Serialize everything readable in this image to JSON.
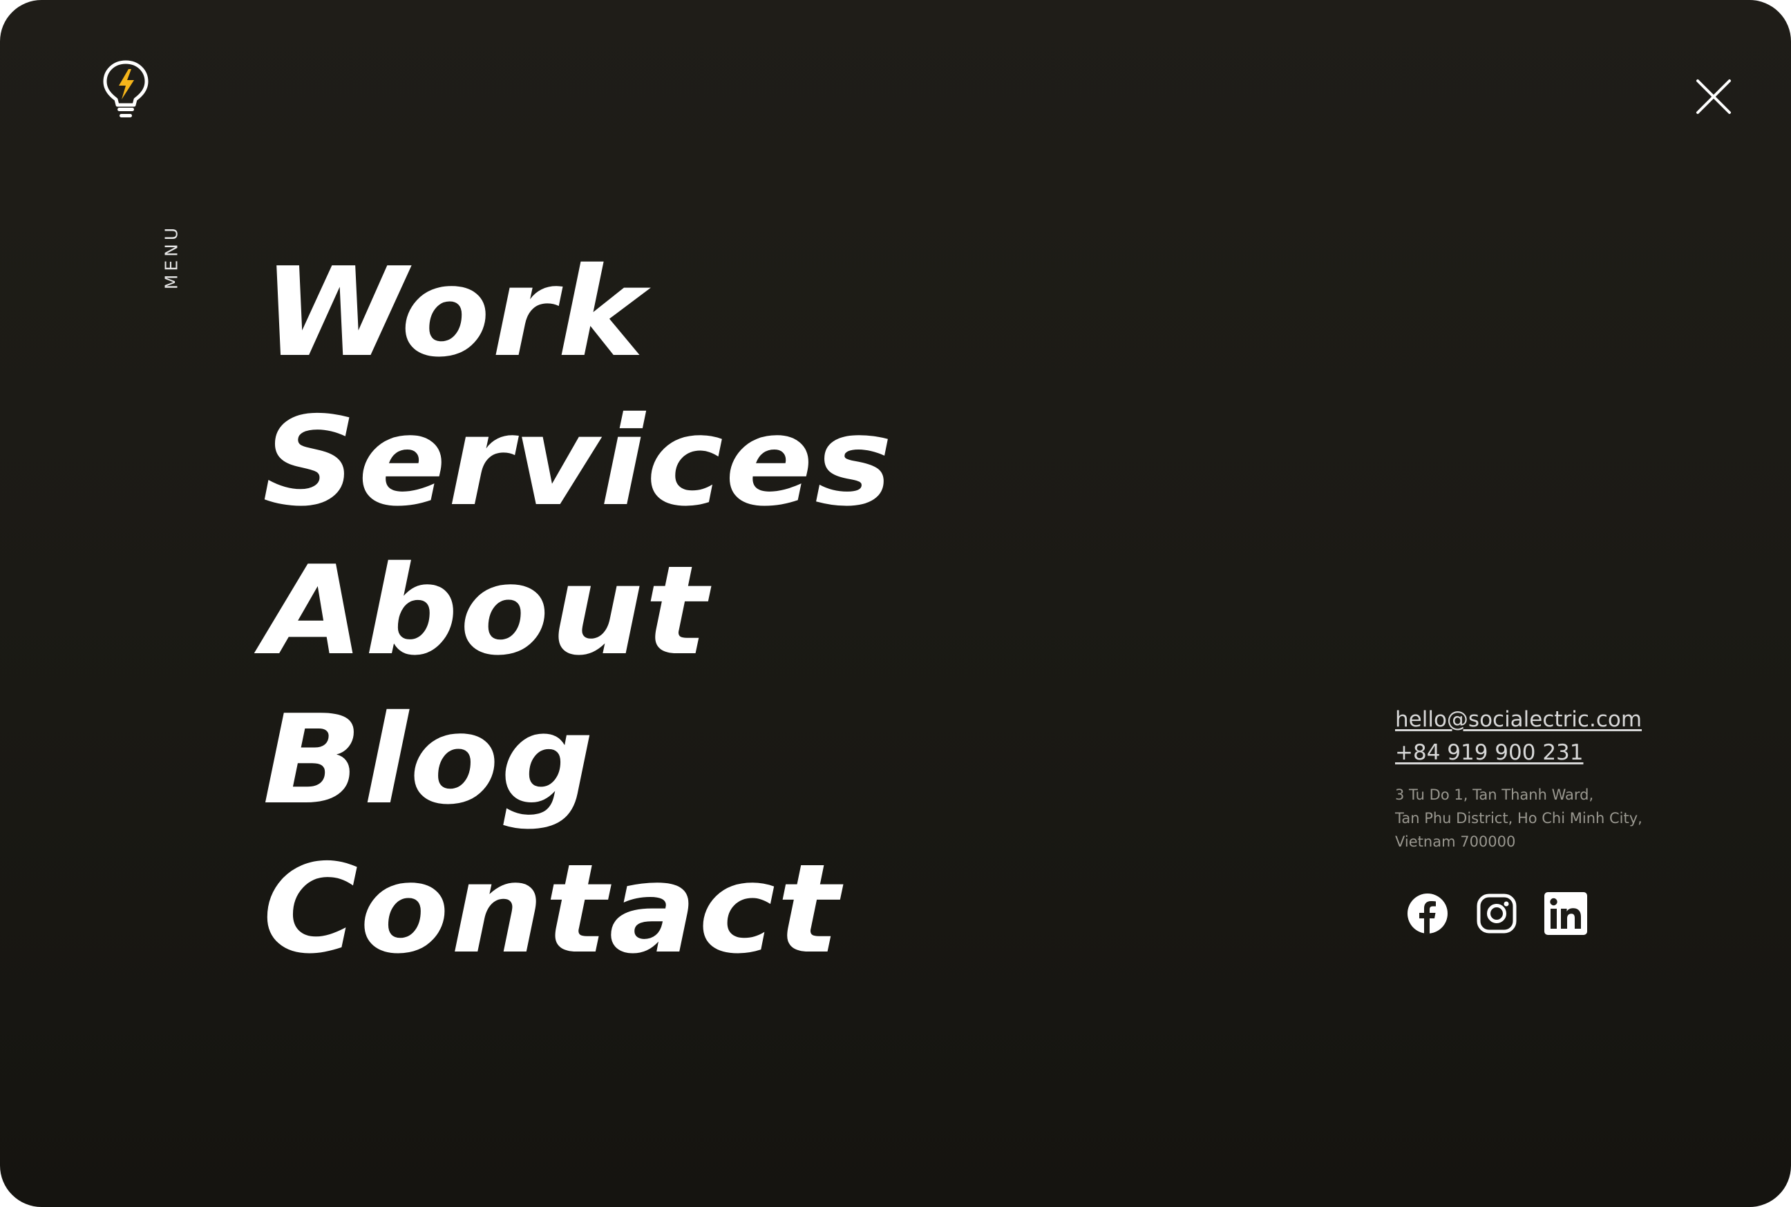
{
  "menu": {
    "label": "MENU",
    "items": [
      {
        "label": "Work"
      },
      {
        "label": "Services"
      },
      {
        "label": "About"
      },
      {
        "label": "Blog"
      },
      {
        "label": "Contact"
      }
    ]
  },
  "contact": {
    "email": "hello@socialectric.com",
    "phone": "+84 919 900 231",
    "address": {
      "line1": "3 Tu Do 1, Tan Thanh Ward,",
      "line2": "Tan Phu District, Ho Chi Minh City,",
      "line3": "Vietnam 700000"
    }
  },
  "social": {
    "icons": [
      "facebook-icon",
      "instagram-icon",
      "linkedin-icon"
    ]
  },
  "icons": {
    "logo": "lightbulb-bolt-icon",
    "close": "close-icon"
  },
  "colors": {
    "background": "#1c1b16",
    "text": "#ffffff",
    "accent": "#f5b51b",
    "muted": "#9a9890"
  }
}
